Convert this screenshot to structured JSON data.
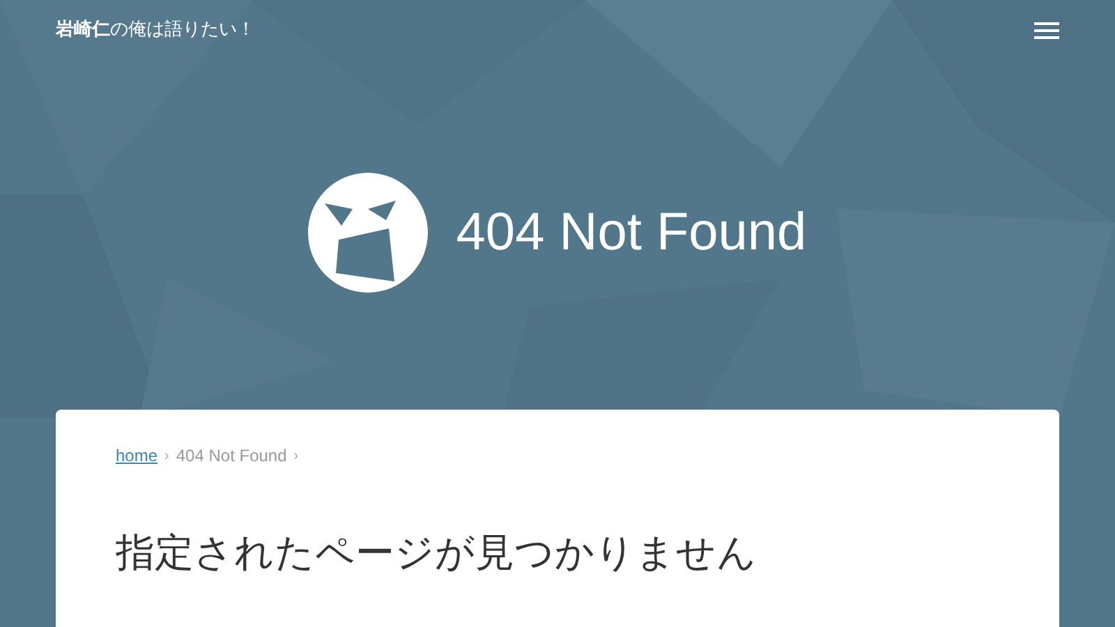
{
  "header": {
    "site_title": "**岩崎仁**の俺は語りたい！"
  },
  "hero": {
    "title": "404 Not Found"
  },
  "breadcrumb": [
    {
      "label": "home",
      "kind": "link"
    },
    {
      "label": "›",
      "kind": "separator"
    },
    {
      "label": "404 Not Found",
      "kind": "current"
    },
    {
      "label": "›",
      "kind": "separator"
    }
  ],
  "content": {
    "heading": "指定されたページが見つかりません"
  }
}
